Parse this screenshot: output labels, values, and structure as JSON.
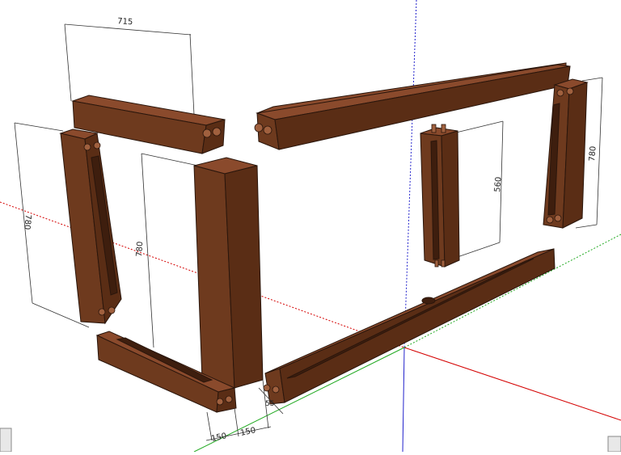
{
  "dimensions": {
    "top_rail_length": "715",
    "left_post_height": "780",
    "front_post_height": "780",
    "middle_post_height": "560",
    "right_post_height": "780",
    "bottom_left_width": "150",
    "bottom_right_width": "150",
    "small_gap": "55"
  },
  "colors": {
    "wood_top": "#8a4a2c",
    "wood_front": "#6e3a1e",
    "wood_side": "#5a2d15",
    "axis_red": "#d40000",
    "axis_green": "#22aa22",
    "axis_blue": "#2222cc"
  }
}
